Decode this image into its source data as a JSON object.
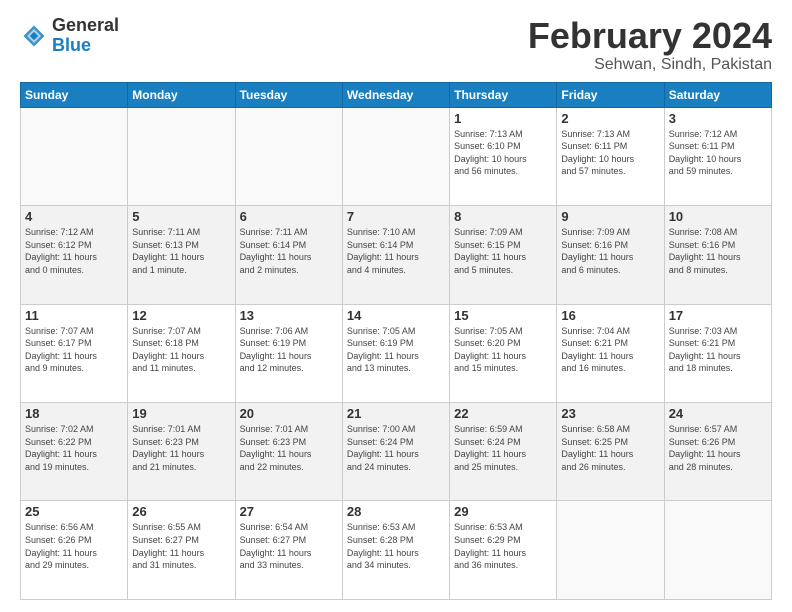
{
  "logo": {
    "text_general": "General",
    "text_blue": "Blue"
  },
  "header": {
    "title": "February 2024",
    "subtitle": "Sehwan, Sindh, Pakistan"
  },
  "days_of_week": [
    "Sunday",
    "Monday",
    "Tuesday",
    "Wednesday",
    "Thursday",
    "Friday",
    "Saturday"
  ],
  "weeks": [
    [
      {
        "day": "",
        "detail": ""
      },
      {
        "day": "",
        "detail": ""
      },
      {
        "day": "",
        "detail": ""
      },
      {
        "day": "",
        "detail": ""
      },
      {
        "day": "1",
        "detail": "Sunrise: 7:13 AM\nSunset: 6:10 PM\nDaylight: 10 hours\nand 56 minutes."
      },
      {
        "day": "2",
        "detail": "Sunrise: 7:13 AM\nSunset: 6:11 PM\nDaylight: 10 hours\nand 57 minutes."
      },
      {
        "day": "3",
        "detail": "Sunrise: 7:12 AM\nSunset: 6:11 PM\nDaylight: 10 hours\nand 59 minutes."
      }
    ],
    [
      {
        "day": "4",
        "detail": "Sunrise: 7:12 AM\nSunset: 6:12 PM\nDaylight: 11 hours\nand 0 minutes."
      },
      {
        "day": "5",
        "detail": "Sunrise: 7:11 AM\nSunset: 6:13 PM\nDaylight: 11 hours\nand 1 minute."
      },
      {
        "day": "6",
        "detail": "Sunrise: 7:11 AM\nSunset: 6:14 PM\nDaylight: 11 hours\nand 2 minutes."
      },
      {
        "day": "7",
        "detail": "Sunrise: 7:10 AM\nSunset: 6:14 PM\nDaylight: 11 hours\nand 4 minutes."
      },
      {
        "day": "8",
        "detail": "Sunrise: 7:09 AM\nSunset: 6:15 PM\nDaylight: 11 hours\nand 5 minutes."
      },
      {
        "day": "9",
        "detail": "Sunrise: 7:09 AM\nSunset: 6:16 PM\nDaylight: 11 hours\nand 6 minutes."
      },
      {
        "day": "10",
        "detail": "Sunrise: 7:08 AM\nSunset: 6:16 PM\nDaylight: 11 hours\nand 8 minutes."
      }
    ],
    [
      {
        "day": "11",
        "detail": "Sunrise: 7:07 AM\nSunset: 6:17 PM\nDaylight: 11 hours\nand 9 minutes."
      },
      {
        "day": "12",
        "detail": "Sunrise: 7:07 AM\nSunset: 6:18 PM\nDaylight: 11 hours\nand 11 minutes."
      },
      {
        "day": "13",
        "detail": "Sunrise: 7:06 AM\nSunset: 6:19 PM\nDaylight: 11 hours\nand 12 minutes."
      },
      {
        "day": "14",
        "detail": "Sunrise: 7:05 AM\nSunset: 6:19 PM\nDaylight: 11 hours\nand 13 minutes."
      },
      {
        "day": "15",
        "detail": "Sunrise: 7:05 AM\nSunset: 6:20 PM\nDaylight: 11 hours\nand 15 minutes."
      },
      {
        "day": "16",
        "detail": "Sunrise: 7:04 AM\nSunset: 6:21 PM\nDaylight: 11 hours\nand 16 minutes."
      },
      {
        "day": "17",
        "detail": "Sunrise: 7:03 AM\nSunset: 6:21 PM\nDaylight: 11 hours\nand 18 minutes."
      }
    ],
    [
      {
        "day": "18",
        "detail": "Sunrise: 7:02 AM\nSunset: 6:22 PM\nDaylight: 11 hours\nand 19 minutes."
      },
      {
        "day": "19",
        "detail": "Sunrise: 7:01 AM\nSunset: 6:23 PM\nDaylight: 11 hours\nand 21 minutes."
      },
      {
        "day": "20",
        "detail": "Sunrise: 7:01 AM\nSunset: 6:23 PM\nDaylight: 11 hours\nand 22 minutes."
      },
      {
        "day": "21",
        "detail": "Sunrise: 7:00 AM\nSunset: 6:24 PM\nDaylight: 11 hours\nand 24 minutes."
      },
      {
        "day": "22",
        "detail": "Sunrise: 6:59 AM\nSunset: 6:24 PM\nDaylight: 11 hours\nand 25 minutes."
      },
      {
        "day": "23",
        "detail": "Sunrise: 6:58 AM\nSunset: 6:25 PM\nDaylight: 11 hours\nand 26 minutes."
      },
      {
        "day": "24",
        "detail": "Sunrise: 6:57 AM\nSunset: 6:26 PM\nDaylight: 11 hours\nand 28 minutes."
      }
    ],
    [
      {
        "day": "25",
        "detail": "Sunrise: 6:56 AM\nSunset: 6:26 PM\nDaylight: 11 hours\nand 29 minutes."
      },
      {
        "day": "26",
        "detail": "Sunrise: 6:55 AM\nSunset: 6:27 PM\nDaylight: 11 hours\nand 31 minutes."
      },
      {
        "day": "27",
        "detail": "Sunrise: 6:54 AM\nSunset: 6:27 PM\nDaylight: 11 hours\nand 33 minutes."
      },
      {
        "day": "28",
        "detail": "Sunrise: 6:53 AM\nSunset: 6:28 PM\nDaylight: 11 hours\nand 34 minutes."
      },
      {
        "day": "29",
        "detail": "Sunrise: 6:53 AM\nSunset: 6:29 PM\nDaylight: 11 hours\nand 36 minutes."
      },
      {
        "day": "",
        "detail": ""
      },
      {
        "day": "",
        "detail": ""
      }
    ]
  ]
}
